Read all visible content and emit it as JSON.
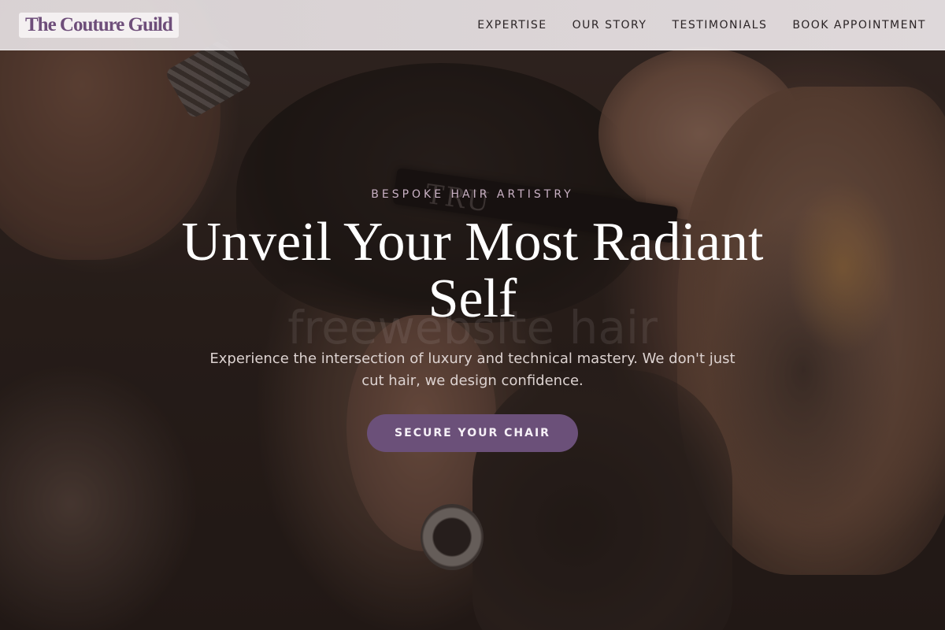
{
  "header": {
    "brand": "The Couture Guild",
    "nav": [
      "EXPERTISE",
      "OUR STORY",
      "TESTIMONIALS",
      "BOOK APPOINTMENT"
    ]
  },
  "hero": {
    "eyebrow": "BESPOKE HAIR ARTISTRY",
    "headline": "Unveil Your Most Radiant Self",
    "subtext": "Experience the intersection of luxury and technical mastery. We don't just cut hair, we design confidence.",
    "cta_label": "SECURE YOUR CHAIR",
    "watermark": "freewebsite hair",
    "comb_text": "TRU"
  },
  "colors": {
    "brand": "#6e4e7a",
    "cta_background": "#6b5079",
    "eyebrow": "#c9b1c4"
  }
}
